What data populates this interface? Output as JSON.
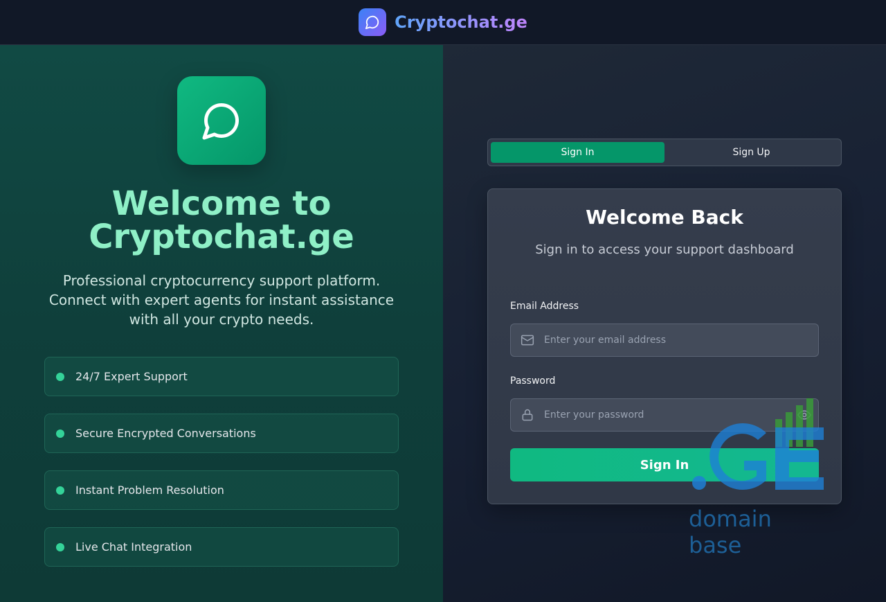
{
  "header": {
    "brand_name": "Cryptochat.ge",
    "brand_icon": "chat-bubble-icon"
  },
  "hero": {
    "icon": "chat-bubble-icon",
    "title": "Welcome to Cryptochat.ge",
    "subtitle": "Professional cryptocurrency support platform. Connect with expert agents for instant assistance with all your crypto needs."
  },
  "features": [
    {
      "label": "24/7 Expert Support"
    },
    {
      "label": "Secure Encrypted Conversations"
    },
    {
      "label": "Instant Problem Resolution"
    },
    {
      "label": "Live Chat Integration"
    }
  ],
  "auth": {
    "tabs": [
      {
        "label": "Sign In",
        "active": true
      },
      {
        "label": "Sign Up",
        "active": false
      }
    ],
    "title": "Welcome Back",
    "subtitle": "Sign in to access your support dashboard",
    "email": {
      "label": "Email Address",
      "placeholder": "Enter your email address",
      "value": "",
      "icon": "mail-icon"
    },
    "password": {
      "label": "Password",
      "placeholder": "Enter your password",
      "value": "",
      "icon": "lock-icon",
      "toggle_icon": "eye-icon"
    },
    "submit_label": "Sign In"
  },
  "watermark": {
    "logo_text": ".GE",
    "text": "domain base"
  },
  "colors": {
    "accent_green": "#10b981",
    "tab_active": "#059669",
    "hero_title": "#8ff0c7",
    "brand_gradient_start": "#60a5fa",
    "brand_gradient_end": "#c084fc"
  }
}
